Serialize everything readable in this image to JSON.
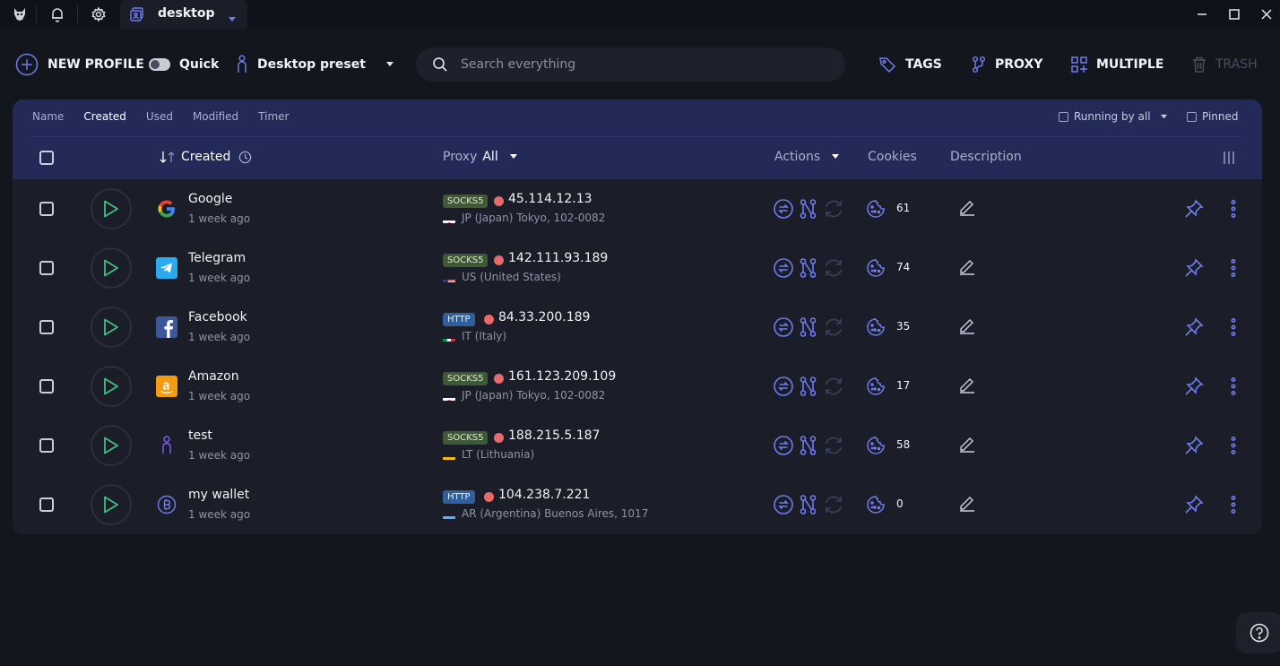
{
  "titlebar": {
    "tab_label": "desktop"
  },
  "toolbar": {
    "new_profile": "NEW PROFILE",
    "quick": "Quick",
    "preset": "Desktop preset",
    "search_placeholder": "Search everything",
    "tags": "TAGS",
    "proxy": "PROXY",
    "multiple": "MULTIPLE",
    "trash": "TRASH"
  },
  "sort_tabs": [
    "Name",
    "Created",
    "Used",
    "Modified",
    "Timer"
  ],
  "filters": {
    "running": "Running by all",
    "pinned": "Pinned"
  },
  "columns": {
    "created": "Created",
    "proxy": "Proxy",
    "proxy_filter": "All",
    "actions": "Actions",
    "cookies": "Cookies",
    "description": "Description"
  },
  "profiles": [
    {
      "name": "Google",
      "date": "1 week ago",
      "proxy_type": "SOCKS5",
      "ip": "45.114.12.13",
      "location": "JP (Japan) Tokyo, 102-0082",
      "flag": "jp",
      "cookies": "61",
      "logo": "google-logo"
    },
    {
      "name": "Telegram",
      "date": "1 week ago",
      "proxy_type": "SOCKS5",
      "ip": "142.111.93.189",
      "location": "US (United States)",
      "flag": "us",
      "cookies": "74",
      "logo": "telegram-logo"
    },
    {
      "name": "Facebook",
      "date": "1 week ago",
      "proxy_type": "HTTP",
      "ip": "84.33.200.189",
      "location": "IT (Italy)",
      "flag": "it",
      "cookies": "35",
      "logo": "facebook-logo"
    },
    {
      "name": "Amazon",
      "date": "1 week ago",
      "proxy_type": "SOCKS5",
      "ip": "161.123.209.109",
      "location": "JP (Japan) Tokyo, 102-0082",
      "flag": "jp",
      "cookies": "17",
      "logo": "amazon-logo"
    },
    {
      "name": "test",
      "date": "1 week ago",
      "proxy_type": "SOCKS5",
      "ip": "188.215.5.187",
      "location": "LT (Lithuania)",
      "flag": "lt",
      "cookies": "58",
      "logo": "person-icon"
    },
    {
      "name": "my wallet",
      "date": "1 week ago",
      "proxy_type": "HTTP",
      "ip": "104.238.7.221",
      "location": "AR (Argentina) Buenos Aires, 1017",
      "flag": "ar",
      "cookies": "0",
      "logo": "bitcoin-icon"
    }
  ],
  "colors": {
    "accent": "#5b6cf0",
    "header_bg": "#232a58",
    "play_green": "#3fbf7f",
    "socks_badge": "#3d5a35",
    "http_badge": "#2f5f9c",
    "status_dot": "#e86a6a"
  }
}
